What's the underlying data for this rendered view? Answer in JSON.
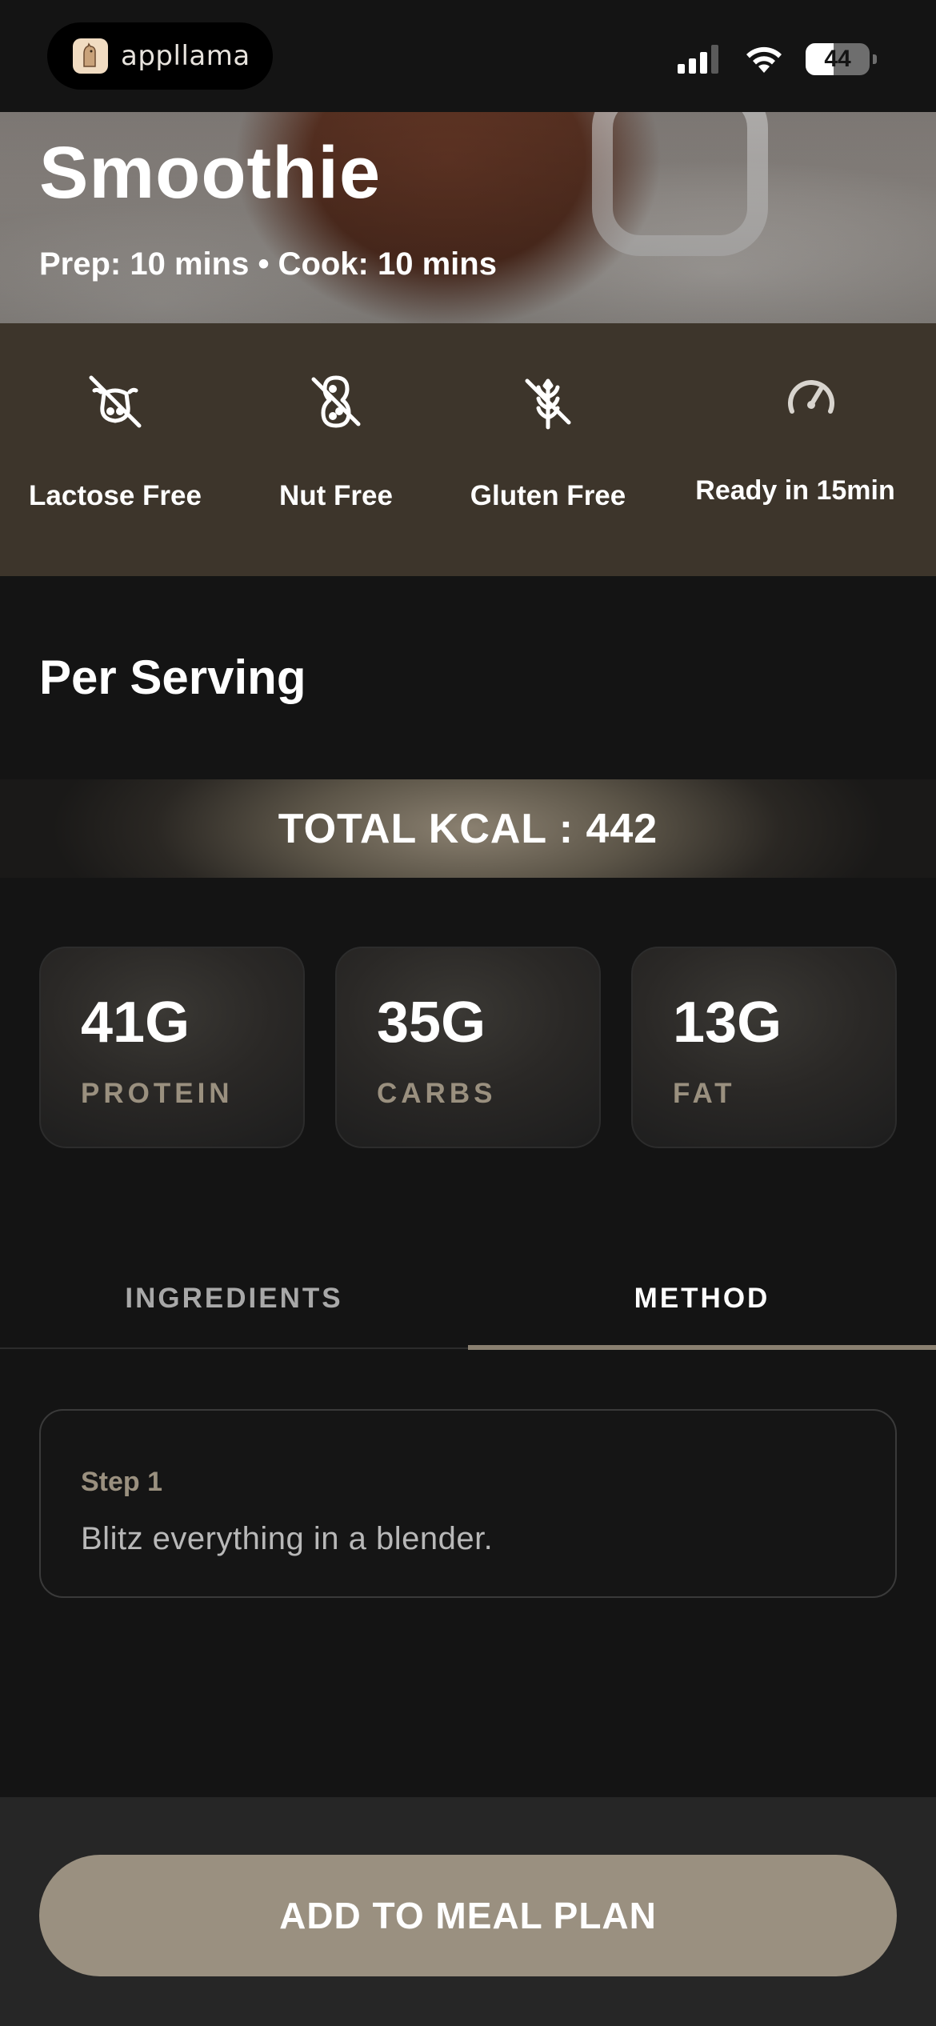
{
  "status_bar": {
    "brand_name": "appllama",
    "battery_level": "44",
    "battery_fraction": 0.44,
    "icons": [
      "signal-icon",
      "wifi-icon",
      "battery-icon"
    ]
  },
  "hero": {
    "title": "Smoothie",
    "meta": "Prep: 10 mins • Cook: 10 mins"
  },
  "features": [
    {
      "label": "Lactose Free",
      "icon": "lactose-free-icon"
    },
    {
      "label": "Nut Free",
      "icon": "nut-free-icon"
    },
    {
      "label": "Gluten Free",
      "icon": "gluten-free-icon"
    },
    {
      "label": "Ready in 15min",
      "icon": "speedometer-icon"
    }
  ],
  "nutrition": {
    "heading": "Per Serving",
    "total_kcal": "TOTAL KCAL : 442",
    "macros": [
      {
        "value": "41G",
        "label": "PROTEIN"
      },
      {
        "value": "35G",
        "label": "CARBS"
      },
      {
        "value": "13G",
        "label": "FAT"
      }
    ]
  },
  "tabs": {
    "ingredients": "INGREDIENTS",
    "method": "METHOD",
    "active": "method"
  },
  "method": {
    "steps": [
      {
        "title": "Step 1",
        "text": "Blitz everything in a blender."
      }
    ]
  },
  "cta": {
    "label": "ADD TO MEAL PLAN"
  },
  "colors": {
    "background": "#141414",
    "feature_band": "#3d352b",
    "accent": "#9a9080",
    "muted_label": "#9a907f"
  }
}
